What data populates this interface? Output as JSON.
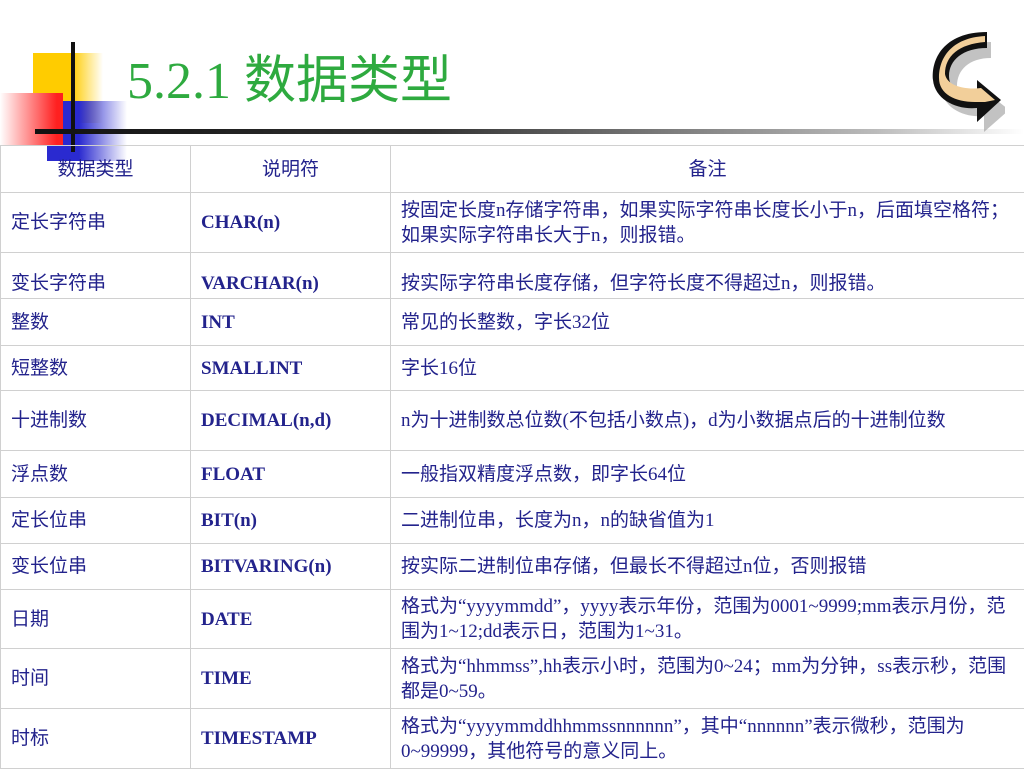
{
  "slide": {
    "title": "5.2.1 数据类型",
    "return_icon": "curved-arrow-icon"
  },
  "table": {
    "headers": [
      "数据类型",
      "说明符",
      "备注"
    ],
    "rows": [
      {
        "type": "定长字符串",
        "spec": "CHAR(n)",
        "note": "按固定长度n存储字符串，如果实际字符串长度长小于n，后面填空格符；如果实际字符串长大于n，则报错。"
      },
      {
        "type": "变长字符串",
        "spec": "VARCHAR(n)",
        "note": "按实际字符串长度存储，但字符长度不得超过n，则报错。"
      },
      {
        "type": "整数",
        "spec": "INT",
        "note": "常见的长整数，字长32位"
      },
      {
        "type": "短整数",
        "spec": "SMALLINT",
        "note": "字长16位"
      },
      {
        "type": "十进制数",
        "spec": "DECIMAL(n,d)",
        "note": "n为十进制数总位数(不包括小数点)，d为小数据点后的十进制位数"
      },
      {
        "type": "浮点数",
        "spec": "FLOAT",
        "note": "一般指双精度浮点数，即字长64位"
      },
      {
        "type": "定长位串",
        "spec": "BIT(n)",
        "note": "二进制位串，长度为n，n的缺省值为1"
      },
      {
        "type": "变长位串",
        "spec": "BITVARING(n)",
        "note": "按实际二进制位串存储，但最长不得超过n位，否则报错"
      },
      {
        "type": "日期",
        "spec": "DATE",
        "note": "格式为“yyyymmdd”，yyyy表示年份，范围为0001~9999;mm表示月份，范围为1~12;dd表示日，范围为1~31。"
      },
      {
        "type": "时间",
        "spec": "TIME",
        "note": "格式为“hhmmss”,hh表示小时，范围为0~24；mm为分钟，ss表示秒，范围都是0~59。"
      },
      {
        "type": "时标",
        "spec": "TIMESTAMP",
        "note": "格式为“yyyymmddhhmmssnnnnnn”，其中“nnnnnn”表示微秒，范围为0~99999，其他符号的意义同上。"
      }
    ]
  }
}
